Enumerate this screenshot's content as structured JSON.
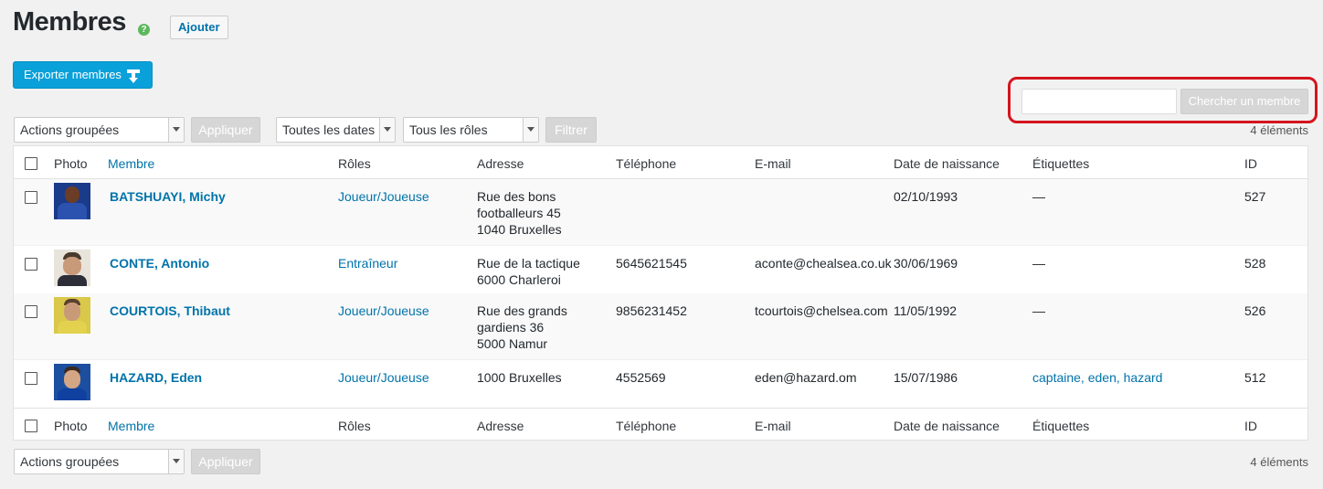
{
  "page": {
    "title": "Membres",
    "add_label": "Ajouter",
    "export_label": "Exporter membres"
  },
  "search": {
    "value": "",
    "button_label": "Chercher un membre"
  },
  "filters": {
    "bulk_actions": "Actions groupées",
    "apply_label": "Appliquer",
    "dates": "Toutes les dates",
    "roles": "Tous les rôles",
    "filter_label": "Filtrer",
    "count_label": "4 éléments"
  },
  "table": {
    "columns": [
      "Photo",
      "Membre",
      "Rôles",
      "Adresse",
      "Téléphone",
      "E-mail",
      "Date de naissance",
      "Étiquettes",
      "ID"
    ],
    "rows": [
      {
        "member": "BATSHUAYI, Michy",
        "role": "Joueur/Joueuse",
        "address": [
          "Rue des bons",
          "footballeurs 45",
          "1040 Bruxelles"
        ],
        "phone": "",
        "email": "",
        "birthdate": "02/10/1993",
        "tags": "—",
        "id": "527",
        "photo_colors": [
          "#1a3a8a",
          "#6b3d26"
        ]
      },
      {
        "member": "CONTE, Antonio",
        "role": "Entraîneur",
        "address": [
          "Rue de la tactique",
          "6000 Charleroi"
        ],
        "phone": "5645621545",
        "email": "aconte@chealsea.co.uk",
        "birthdate": "30/06/1969",
        "tags": "—",
        "id": "528",
        "photo_colors": [
          "#e8e4dc",
          "#c99a7a"
        ]
      },
      {
        "member": "COURTOIS, Thibaut",
        "role": "Joueur/Joueuse",
        "address": [
          "Rue des grands",
          "gardiens 36",
          "5000 Namur"
        ],
        "phone": "9856231452",
        "email": "tcourtois@chelsea.com",
        "birthdate": "11/05/1992",
        "tags": "—",
        "id": "526",
        "photo_colors": [
          "#d9c84a",
          "#c89a78"
        ]
      },
      {
        "member": "HAZARD, Eden",
        "role": "Joueur/Joueuse",
        "address": [
          "1000 Bruxelles"
        ],
        "phone": "4552569",
        "email": "eden@hazard.om",
        "birthdate": "15/07/1986",
        "tags": "captaine, eden, hazard",
        "id": "512",
        "photo_colors": [
          "#1c4fa0",
          "#d4a684"
        ]
      }
    ]
  },
  "bottom": {
    "bulk_actions": "Actions groupées",
    "apply_label": "Appliquer",
    "count_label": "4 éléments"
  },
  "colors": {
    "accent": "#0073aa",
    "export_button": "#0aa0d9",
    "highlight_frame": "#d4151e"
  }
}
